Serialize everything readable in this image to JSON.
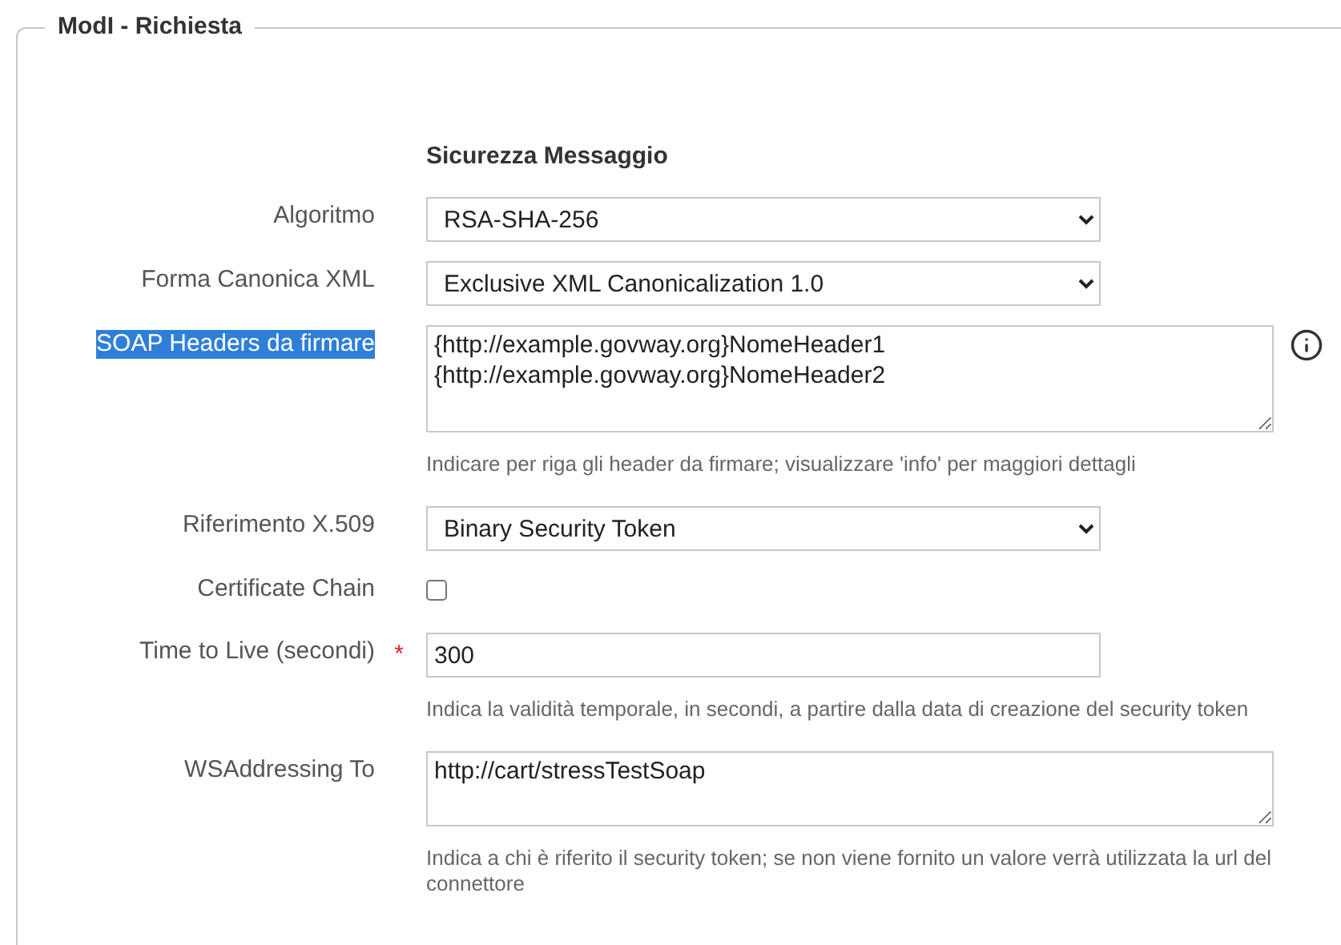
{
  "fieldset": {
    "legend": "ModI - Richiesta"
  },
  "section_title": "Sicurezza Messaggio",
  "fields": [
    {
      "kind": "select",
      "label": "Algoritmo",
      "label_highlighted": false,
      "value": "RSA-SHA-256"
    },
    {
      "kind": "select",
      "label": "Forma Canonica XML",
      "label_highlighted": false,
      "value": "Exclusive XML Canonicalization 1.0"
    },
    {
      "kind": "textarea",
      "label": "SOAP Headers da firmare",
      "label_highlighted": true,
      "info": true,
      "lines": [
        "{http://example.govway.org}NomeHeader1",
        "{http://example.govway.org}NomeHeader2"
      ],
      "hint": "Indicare per riga gli header da firmare; visualizzare 'info' per maggiori dettagli"
    },
    {
      "kind": "select",
      "label": "Riferimento X.509",
      "label_highlighted": false,
      "value": "Binary Security Token"
    },
    {
      "kind": "checkbox",
      "label": "Certificate Chain",
      "label_highlighted": false,
      "checked": false
    },
    {
      "kind": "text",
      "label": "Time to Live (secondi)",
      "label_highlighted": false,
      "required_mark": "*",
      "value": "300",
      "hint": "Indica la validità temporale, in secondi, a partire dalla data di creazione del security token"
    },
    {
      "kind": "textarea",
      "label": "WSAddressing To",
      "label_highlighted": false,
      "lines": [
        "http://cart/stressTestSoap"
      ],
      "hint": "Indica a chi è riferito il security token; se non viene fornito un valore verrà utilizzata la url del connettore"
    }
  ]
}
